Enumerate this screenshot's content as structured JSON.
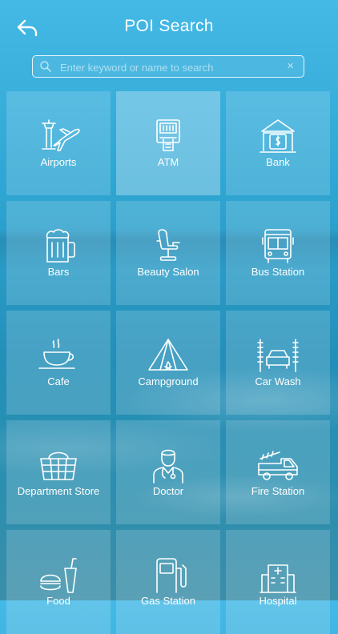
{
  "header": {
    "title": "POI Search",
    "back_icon": "back-arrow-icon"
  },
  "search": {
    "placeholder": "Enter keyword or name to search",
    "value": "",
    "clear_label": "×"
  },
  "categories": [
    {
      "label": "Airports",
      "icon": "airport-icon"
    },
    {
      "label": "ATM",
      "icon": "atm-icon"
    },
    {
      "label": "Bank",
      "icon": "bank-icon"
    },
    {
      "label": "Bars",
      "icon": "beer-mug-icon"
    },
    {
      "label": "Beauty Salon",
      "icon": "salon-chair-icon"
    },
    {
      "label": "Bus Station",
      "icon": "bus-icon"
    },
    {
      "label": "Cafe",
      "icon": "coffee-cup-icon"
    },
    {
      "label": "Campground",
      "icon": "tent-icon"
    },
    {
      "label": "Car Wash",
      "icon": "car-wash-icon"
    },
    {
      "label": "Department Store",
      "icon": "basket-icon"
    },
    {
      "label": "Doctor",
      "icon": "doctor-icon"
    },
    {
      "label": "Fire Station",
      "icon": "fire-truck-icon"
    },
    {
      "label": "Food",
      "icon": "fast-food-icon"
    },
    {
      "label": "Gas Station",
      "icon": "gas-pump-icon"
    },
    {
      "label": "Hospital",
      "icon": "hospital-icon"
    }
  ]
}
